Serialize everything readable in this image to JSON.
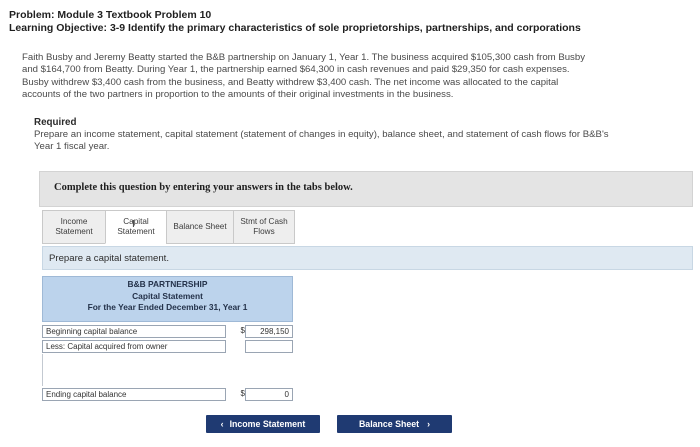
{
  "header": {
    "problem_label": "Problem: Module 3 Textbook Problem 10",
    "objective_label": "Learning Objective: 3-9 Identify the primary characteristics of sole proprietorships, partnerships, and corporations"
  },
  "problem_text": [
    "Faith Busby and Jeremy Beatty started the B&B partnership on January 1, Year 1. The business acquired $105,300 cash from Busby",
    "and $164,700 from Beatty. During Year 1, the partnership earned $64,300 in cash revenues and paid $29,350 for cash expenses.",
    "Busby withdrew $3,400 cash from the business, and Beatty withdrew $3,400 cash. The net income was allocated to the capital",
    "accounts of the two partners in proportion to the amounts of their original investments in the business."
  ],
  "required": {
    "title": "Required",
    "lines": [
      "Prepare an income statement, capital statement (statement of changes in equity), balance sheet, and statement of cash flows for B&B's",
      "Year 1 fiscal year."
    ]
  },
  "instruction": "Complete this question by entering your answers in the tabs below.",
  "tabs": [
    {
      "label": "Income\nStatement",
      "active": false
    },
    {
      "label": "Capital\nStatement",
      "active": true
    },
    {
      "label": "Balance Sheet",
      "active": false
    },
    {
      "label": "Stmt of Cash\nFlows",
      "active": false
    }
  ],
  "prompt": "Prepare a capital statement.",
  "statement": {
    "company": "B&B PARTNERSHIP",
    "title": "Capital Statement",
    "period": "For the Year Ended December 31, Year 1",
    "rows": [
      {
        "label": "Beginning capital balance",
        "currency": "$",
        "value": "298,150"
      },
      {
        "label": "Less: Capital acquired from owner",
        "currency": "",
        "value": ""
      },
      {
        "label": "Ending capital balance",
        "currency": "$",
        "value": "0"
      }
    ]
  },
  "buttons": {
    "prev": "Income Statement",
    "next": "Balance Sheet"
  }
}
